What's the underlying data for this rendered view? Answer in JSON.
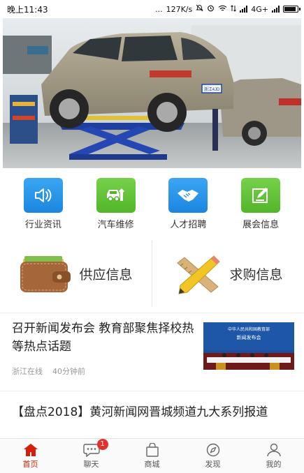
{
  "status_bar": {
    "time": "晚上11:43",
    "dots": "...",
    "speed": "127K/s",
    "network": "4G+"
  },
  "hero": {
    "plate_text": "浙江4JD"
  },
  "categories": [
    {
      "label": "行业资讯",
      "icon": "speaker-icon",
      "color": "#2196f3"
    },
    {
      "label": "汽车维修",
      "icon": "car-repair-icon",
      "color": "#5cbf2a"
    },
    {
      "label": "人才招聘",
      "icon": "handshake-icon",
      "color": "#2196f3"
    },
    {
      "label": "展会信息",
      "icon": "edit-note-icon",
      "color": "#5cbf2a"
    }
  ],
  "supply_demand": {
    "supply_label": "供应信息",
    "demand_label": "求购信息"
  },
  "news": [
    {
      "title": "召开新闻发布会 教育部聚焦择校热等热点话题",
      "source": "浙江在线",
      "time": "40分钟前",
      "thumb_banner": "中华人民共和国教育部",
      "thumb_caption": "新闻发布会"
    },
    {
      "title": "【盘点2018】黄河新闻网晋城频道九大系列报道"
    }
  ],
  "tabbar": [
    {
      "label": "首页",
      "icon": "home-icon",
      "active": true
    },
    {
      "label": "聊天",
      "icon": "chat-icon",
      "badge": "1"
    },
    {
      "label": "商城",
      "icon": "shopping-bag-icon"
    },
    {
      "label": "发现",
      "icon": "compass-icon"
    },
    {
      "label": "我的",
      "icon": "person-icon"
    }
  ],
  "colors": {
    "accent_red": "#d81e06",
    "badge_red": "#e5312b",
    "icon_blue": "#2196f3",
    "icon_green": "#5cbf2a"
  }
}
